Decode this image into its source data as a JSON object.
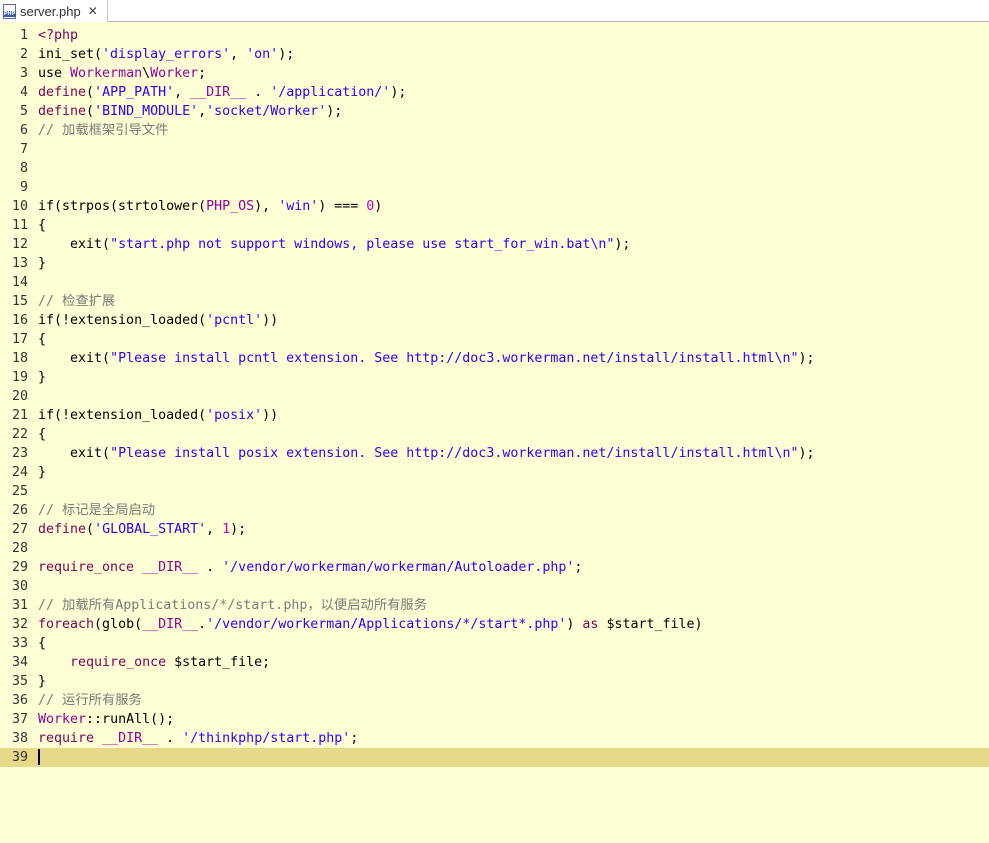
{
  "tab": {
    "filename": "server.php",
    "icon": "php-file-icon",
    "close": "✕"
  },
  "colors": {
    "editor_bg": "#ffffd6",
    "current_line": "#e6d98a",
    "keyword": "#7f0055",
    "string": "#2a00ff",
    "comment": "#7a7a7a",
    "number": "#c000c0",
    "constant": "#990099"
  },
  "current_line": 39,
  "lines": [
    [
      {
        "t": "<?php",
        "c": "kw"
      }
    ],
    [
      {
        "t": "ini_set("
      },
      {
        "t": "'display_errors'",
        "c": "str"
      },
      {
        "t": ", "
      },
      {
        "t": "'on'",
        "c": "str"
      },
      {
        "t": ");"
      }
    ],
    [
      {
        "t": "use "
      },
      {
        "t": "Workerman",
        "c": "const"
      },
      {
        "t": "\\"
      },
      {
        "t": "Worker",
        "c": "const"
      },
      {
        "t": ";"
      }
    ],
    [
      {
        "t": "define",
        "c": "kw"
      },
      {
        "t": "("
      },
      {
        "t": "'APP_PATH'",
        "c": "str"
      },
      {
        "t": ", "
      },
      {
        "t": "__DIR__",
        "c": "const"
      },
      {
        "t": " . "
      },
      {
        "t": "'/application/'",
        "c": "str"
      },
      {
        "t": ");"
      }
    ],
    [
      {
        "t": "define",
        "c": "kw"
      },
      {
        "t": "("
      },
      {
        "t": "'BIND_MODULE'",
        "c": "str"
      },
      {
        "t": ","
      },
      {
        "t": "'socket/Worker'",
        "c": "str"
      },
      {
        "t": ");"
      }
    ],
    [
      {
        "t": "// 加载框架引导文件",
        "c": "cmt"
      }
    ],
    [],
    [],
    [],
    [
      {
        "t": "if(strpos(strtolower("
      },
      {
        "t": "PHP_OS",
        "c": "const"
      },
      {
        "t": "), "
      },
      {
        "t": "'win'",
        "c": "str"
      },
      {
        "t": ") === "
      },
      {
        "t": "0",
        "c": "num"
      },
      {
        "t": ")"
      }
    ],
    [
      {
        "t": "{"
      }
    ],
    [
      {
        "t": "    exit("
      },
      {
        "t": "\"start.php not support windows, please use start_for_win.bat\\n\"",
        "c": "str"
      },
      {
        "t": ");"
      }
    ],
    [
      {
        "t": "}"
      }
    ],
    [],
    [
      {
        "t": "// 检查扩展",
        "c": "cmt"
      }
    ],
    [
      {
        "t": "if(!extension_loaded("
      },
      {
        "t": "'pcntl'",
        "c": "str"
      },
      {
        "t": "))"
      }
    ],
    [
      {
        "t": "{"
      }
    ],
    [
      {
        "t": "    exit("
      },
      {
        "t": "\"Please install pcntl extension. See http://doc3.workerman.net/install/install.html\\n\"",
        "c": "str"
      },
      {
        "t": ");"
      }
    ],
    [
      {
        "t": "}"
      }
    ],
    [],
    [
      {
        "t": "if(!extension_loaded("
      },
      {
        "t": "'posix'",
        "c": "str"
      },
      {
        "t": "))"
      }
    ],
    [
      {
        "t": "{"
      }
    ],
    [
      {
        "t": "    exit("
      },
      {
        "t": "\"Please install posix extension. See http://doc3.workerman.net/install/install.html\\n\"",
        "c": "str"
      },
      {
        "t": ");"
      }
    ],
    [
      {
        "t": "}"
      }
    ],
    [],
    [
      {
        "t": "// 标记是全局启动",
        "c": "cmt"
      }
    ],
    [
      {
        "t": "define",
        "c": "kw"
      },
      {
        "t": "("
      },
      {
        "t": "'GLOBAL_START'",
        "c": "str"
      },
      {
        "t": ", "
      },
      {
        "t": "1",
        "c": "num"
      },
      {
        "t": ");"
      }
    ],
    [],
    [
      {
        "t": "require_once",
        "c": "kw"
      },
      {
        "t": " "
      },
      {
        "t": "__DIR__",
        "c": "const"
      },
      {
        "t": " . "
      },
      {
        "t": "'/vendor/workerman/workerman/Autoloader.php'",
        "c": "str"
      },
      {
        "t": ";"
      }
    ],
    [],
    [
      {
        "t": "// 加载所有Applications/*/start.php，以便启动所有服务",
        "c": "cmt"
      }
    ],
    [
      {
        "t": "foreach",
        "c": "kw"
      },
      {
        "t": "(glob("
      },
      {
        "t": "__DIR__",
        "c": "const"
      },
      {
        "t": "."
      },
      {
        "t": "'/vendor/workerman/Applications/*/start*.php'",
        "c": "str"
      },
      {
        "t": ") "
      },
      {
        "t": "as",
        "c": "kw"
      },
      {
        "t": " $start_file)"
      }
    ],
    [
      {
        "t": "{"
      }
    ],
    [
      {
        "t": "    "
      },
      {
        "t": "require_once",
        "c": "kw"
      },
      {
        "t": " $start_file;"
      }
    ],
    [
      {
        "t": "}"
      }
    ],
    [
      {
        "t": "// 运行所有服务",
        "c": "cmt"
      }
    ],
    [
      {
        "t": "Worker",
        "c": "const"
      },
      {
        "t": "::runAll();"
      }
    ],
    [
      {
        "t": "require",
        "c": "kw"
      },
      {
        "t": " "
      },
      {
        "t": "__DIR__",
        "c": "const"
      },
      {
        "t": " . "
      },
      {
        "t": "'/thinkphp/start.php'",
        "c": "str"
      },
      {
        "t": ";"
      }
    ],
    []
  ]
}
